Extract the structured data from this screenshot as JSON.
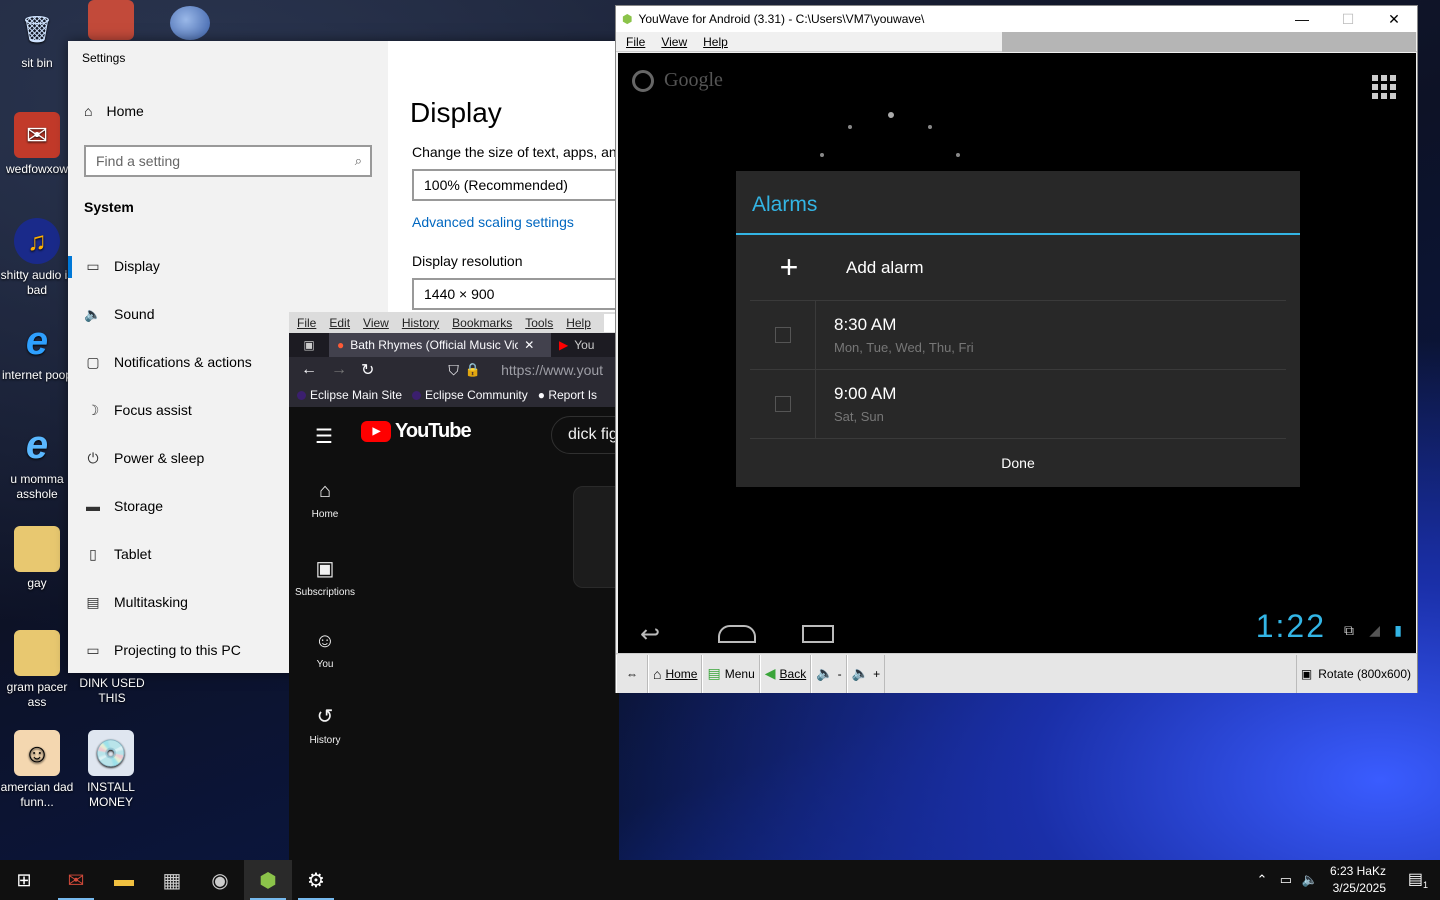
{
  "desktop": {
    "icons": [
      {
        "label": "sit bin",
        "icon": "recycle-bin-icon"
      },
      {
        "label": "wedfowxow",
        "icon": "app-icon"
      },
      {
        "label": "shitty audio is bad",
        "icon": "audio-app-icon"
      },
      {
        "label": "internet poop",
        "icon": "internet-explorer-icon"
      },
      {
        "label": "u momma asshole",
        "icon": "internet-explorer-icon"
      },
      {
        "label": "gay",
        "icon": "folder-icon"
      },
      {
        "label": "gram pacer ass",
        "icon": "folder-icon"
      },
      {
        "label": "DINK USED THIS",
        "icon": "app-icon"
      },
      {
        "label": "amercian dad funn...",
        "icon": "cartoon-icon"
      },
      {
        "label": "INSTALL MONEY",
        "icon": "installer-icon"
      }
    ]
  },
  "settings": {
    "window_title": "Settings",
    "home_label": "Home",
    "search_placeholder": "Find a setting",
    "section_label": "System",
    "nav": [
      {
        "label": "Display",
        "icon": "monitor-icon"
      },
      {
        "label": "Sound",
        "icon": "speaker-icon"
      },
      {
        "label": "Notifications & actions",
        "icon": "notification-icon"
      },
      {
        "label": "Focus assist",
        "icon": "moon-icon"
      },
      {
        "label": "Power & sleep",
        "icon": "power-icon"
      },
      {
        "label": "Storage",
        "icon": "storage-icon"
      },
      {
        "label": "Tablet",
        "icon": "tablet-icon"
      },
      {
        "label": "Multitasking",
        "icon": "multitasking-icon"
      },
      {
        "label": "Projecting to this PC",
        "icon": "projector-icon"
      }
    ],
    "page_title": "Display",
    "scale_label": "Change the size of text, apps, and",
    "scale_value": "100% (Recommended)",
    "advanced_link": "Advanced scaling settings",
    "resolution_label": "Display resolution",
    "resolution_value": "1440 × 900"
  },
  "browser": {
    "menu": [
      "File",
      "Edit",
      "View",
      "History",
      "Bookmarks",
      "Tools",
      "Help"
    ],
    "tab_active": "Bath Rhymes (Official Music Vic",
    "tab_next": "You",
    "url": "https://www.yout",
    "bookmarks": [
      "Eclipse Main Site",
      "Eclipse Community",
      "Report Is"
    ],
    "youtube": {
      "logo_text": "YouTube",
      "search_value": "dick fig",
      "sidebar": [
        {
          "label": "Home",
          "icon": "home-icon"
        },
        {
          "label": "Subscriptions",
          "icon": "subscriptions-icon"
        },
        {
          "label": "You",
          "icon": "user-icon"
        },
        {
          "label": "History",
          "icon": "history-icon"
        }
      ]
    }
  },
  "youwave": {
    "title": "YouWave for Android (3.31) - C:\\Users\\VM7\\youwave\\",
    "menu": [
      "File",
      "View",
      "Help"
    ],
    "android": {
      "search_text": "Google",
      "dialog_title": "Alarms",
      "add_alarm": "Add alarm",
      "alarms": [
        {
          "time": "8:30 AM",
          "days": "Mon, Tue, Wed, Thu, Fri"
        },
        {
          "time": "9:00 AM",
          "days": "Sat, Sun"
        }
      ],
      "done_label": "Done",
      "clock": "1:22"
    },
    "toolbar": {
      "home": "Home",
      "menu": "Menu",
      "back": "Back",
      "vol_down": "-",
      "vol_up": "+",
      "rotate": "Rotate (800x600)"
    }
  },
  "taskbar": {
    "time": "6:23 HaKz",
    "date": "3/25/2025",
    "notifications_count": "1"
  },
  "colors": {
    "accent_blue": "#0078d7",
    "android_holo_blue": "#33b5e5",
    "youtube_red": "#ff0000"
  }
}
